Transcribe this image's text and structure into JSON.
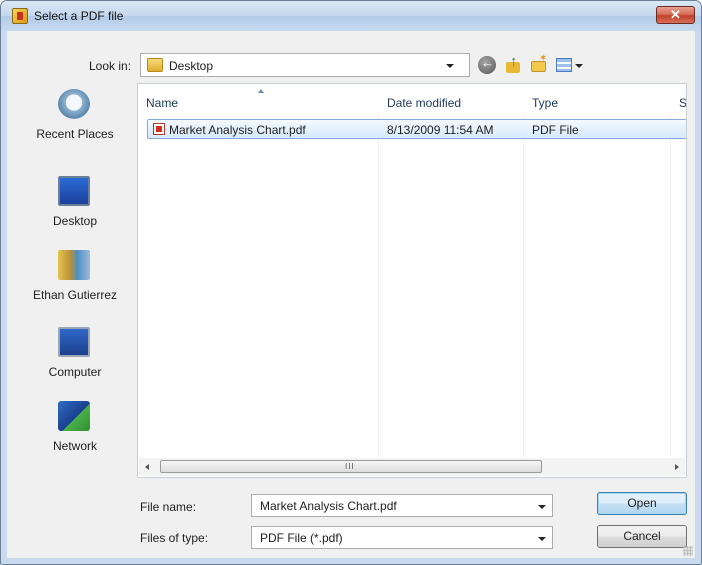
{
  "window": {
    "title": "Select a PDF file",
    "close_glyph": "✕"
  },
  "toolbar": {
    "look_in_label": "Look in:",
    "look_in_value": "Desktop",
    "icons": [
      "back-icon",
      "up-folder-icon",
      "new-folder-icon",
      "view-menu-icon"
    ]
  },
  "places": [
    {
      "label": "Recent Places",
      "icon": "recent-places-icon"
    },
    {
      "label": "Desktop",
      "icon": "desktop-icon"
    },
    {
      "label": "Ethan Gutierrez",
      "icon": "user-folder-icon"
    },
    {
      "label": "Computer",
      "icon": "computer-icon"
    },
    {
      "label": "Network",
      "icon": "network-icon"
    }
  ],
  "file_list": {
    "columns": [
      "Name",
      "Date modified",
      "Type",
      "Si"
    ],
    "rows": [
      {
        "name": "Market Analysis Chart.pdf",
        "date_modified": "8/13/2009 11:54 AM",
        "type": "PDF File",
        "icon": "pdf-file-icon",
        "selected": true
      }
    ],
    "scroll_grip": "III"
  },
  "fields": {
    "file_name_label": "File name:",
    "file_name_value": "Market Analysis Chart.pdf",
    "file_type_label": "Files of type:",
    "file_type_value": "PDF File (*.pdf)"
  },
  "buttons": {
    "open": "Open",
    "cancel": "Cancel"
  }
}
